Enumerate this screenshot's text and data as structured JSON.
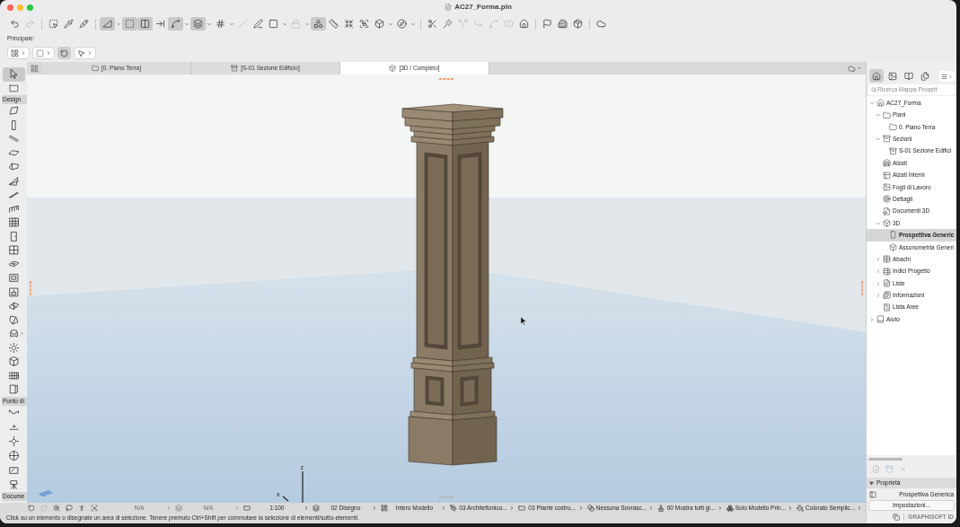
{
  "window": {
    "title": "AC27_Forma.pln"
  },
  "toolbar": {
    "groups": [
      [
        {
          "on": false,
          "disabled": false
        },
        {
          "on": false,
          "disabled": true
        }
      ],
      [
        {
          "on": false,
          "disabled": false
        },
        {
          "on": false,
          "disabled": false
        },
        {
          "on": false,
          "disabled": false
        }
      ],
      [
        {
          "on": true,
          "disabled": false
        },
        {
          "on": true,
          "disabled": false
        },
        {
          "on": true,
          "disabled": false
        },
        {
          "on": false,
          "disabled": false
        },
        {
          "on": true,
          "disabled": false
        },
        {
          "on": true,
          "disabled": false
        },
        {
          "on": false,
          "disabled": false
        },
        {
          "on": false,
          "disabled": true
        },
        {
          "on": false,
          "disabled": false
        },
        {
          "on": false,
          "disabled": false
        },
        {
          "on": false,
          "disabled": true
        },
        {
          "on": true,
          "disabled": false
        },
        {
          "on": false,
          "disabled": false
        },
        {
          "on": false,
          "disabled": false
        },
        {
          "on": false,
          "disabled": false
        },
        {
          "on": false,
          "disabled": false
        },
        {
          "on": false,
          "disabled": false
        }
      ],
      [
        {
          "on": false,
          "disabled": false
        },
        {
          "on": false,
          "disabled": false
        },
        {
          "on": false,
          "disabled": true
        },
        {
          "on": false,
          "disabled": true
        },
        {
          "on": false,
          "disabled": true
        },
        {
          "on": false,
          "disabled": true
        },
        {
          "on": false,
          "disabled": false
        }
      ],
      [
        {
          "on": false,
          "disabled": false
        },
        {
          "on": false,
          "disabled": false
        },
        {
          "on": false,
          "disabled": false
        }
      ],
      [
        {
          "on": false,
          "disabled": false
        }
      ]
    ]
  },
  "info_box": {
    "label": "Principale:",
    "buttons": [
      {
        "on": false
      },
      {
        "on": false
      },
      {
        "on": true
      },
      {
        "on": false
      }
    ]
  },
  "toolbox": {
    "sections": [
      {
        "items": [
          {
            "selected": true
          },
          {
            "selected": false
          }
        ]
      },
      {
        "title": "Design",
        "items": [
          {
            "selected": false
          },
          {
            "selected": false
          },
          {
            "selected": false
          },
          {
            "selected": false
          },
          {
            "selected": false
          },
          {
            "selected": false
          },
          {
            "selected": false
          },
          {
            "selected": false
          },
          {
            "selected": false
          },
          {
            "selected": false
          },
          {
            "selected": false
          },
          {
            "selected": false
          },
          {
            "selected": false
          },
          {
            "selected": false
          },
          {
            "selected": false
          },
          {
            "selected": false
          },
          {
            "selected": false
          },
          {
            "selected": false
          },
          {
            "selected": false
          },
          {
            "selected": false
          },
          {
            "selected": false
          }
        ]
      },
      {
        "title": "Punto di",
        "items": [
          {
            "selected": false
          },
          {
            "selected": false
          },
          {
            "selected": false
          },
          {
            "selected": false
          },
          {
            "selected": false
          },
          {
            "selected": false
          }
        ]
      },
      {
        "title": "Docume"
      }
    ]
  },
  "view_tabs": [
    {
      "label": "[0. Piano Terra]",
      "selected": false
    },
    {
      "label": "[S-01 Sezione Edificio]",
      "selected": false
    },
    {
      "label": "[3D / Completo]",
      "selected": true
    }
  ],
  "viewport": {
    "axis_labels": [
      "z",
      "x"
    ]
  },
  "status_bar": {
    "items": [
      {
        "text": "N/A",
        "disabled": true
      },
      {
        "text": "N/A",
        "disabled": true
      },
      {
        "text": "1:100",
        "disabled": false
      },
      {
        "text": "02 Disegno",
        "disabled": false
      },
      {
        "text": "Intero Modello",
        "disabled": false
      },
      {
        "text": "03 Architettonico...",
        "disabled": false
      },
      {
        "text": "03 Piante costru...",
        "disabled": false
      },
      {
        "text": "Nessuna Sovrasc...",
        "disabled": false
      },
      {
        "text": "00 Mostra tutti gl...",
        "disabled": false
      },
      {
        "text": "Solo Modello Prin...",
        "disabled": false
      },
      {
        "text": "Colorato Semplic...",
        "disabled": false
      }
    ],
    "message": "Click su un elemento o disegnate un area di selezione. Tenere premuto Ctrl+Shift per commutare la selezione di elementi/sotto-elementi."
  },
  "navigator": {
    "modes": [
      {
        "selected": true
      },
      {
        "selected": false
      },
      {
        "selected": false
      },
      {
        "selected": false
      }
    ],
    "search": {
      "placeholder": "Ricerca Mappa Progett"
    },
    "tree": [
      {
        "label": "AC27_Forma",
        "kind": "branch",
        "expanded": true,
        "selected": false,
        "children": [
          {
            "label": "Piani",
            "kind": "branch",
            "expanded": true,
            "selected": false,
            "children": [
              {
                "label": "0. Piano Terra",
                "kind": "leaf",
                "selected": false
              }
            ]
          },
          {
            "label": "Sezioni",
            "kind": "branch",
            "expanded": true,
            "selected": false,
            "children": [
              {
                "label": "S-01 Sezione Edifici",
                "kind": "leaf",
                "selected": false
              }
            ]
          },
          {
            "label": "Alzati",
            "kind": "leaf",
            "selected": false
          },
          {
            "label": "Alzati Interni",
            "kind": "leaf",
            "selected": false
          },
          {
            "label": "Fogli di Lavoro",
            "kind": "leaf",
            "selected": false
          },
          {
            "label": "Dettagli",
            "kind": "leaf",
            "selected": false
          },
          {
            "label": "Documenti 3D",
            "kind": "leaf",
            "selected": false
          },
          {
            "label": "3D",
            "kind": "branch",
            "expanded": true,
            "selected": false,
            "children": [
              {
                "label": "Prospettiva Generic",
                "kind": "leaf",
                "selected": true
              },
              {
                "label": "Assonometria Generi",
                "kind": "leaf",
                "selected": false
              }
            ]
          },
          {
            "label": "Abachi",
            "kind": "branch",
            "expanded": false,
            "selected": false
          },
          {
            "label": "Indici Progetto",
            "kind": "branch",
            "expanded": false,
            "selected": false
          },
          {
            "label": "Liste",
            "kind": "branch",
            "expanded": false,
            "selected": false
          },
          {
            "label": "Informazioni",
            "kind": "branch",
            "expanded": false,
            "selected": false
          },
          {
            "label": "Lista Aree",
            "kind": "leaf",
            "selected": false
          }
        ]
      },
      {
        "label": "Aiuto",
        "kind": "branch",
        "expanded": false,
        "selected": false
      }
    ]
  },
  "properties": {
    "actions": [
      {
        "disabled": true
      },
      {
        "disabled": true
      },
      {
        "disabled": true
      }
    ],
    "title": "Proprietà",
    "expanded": true,
    "view_name": "Prospettiva Generica",
    "button": "Impostazioni..."
  },
  "footer": {
    "brand": "GRAPHISOFT ID"
  }
}
